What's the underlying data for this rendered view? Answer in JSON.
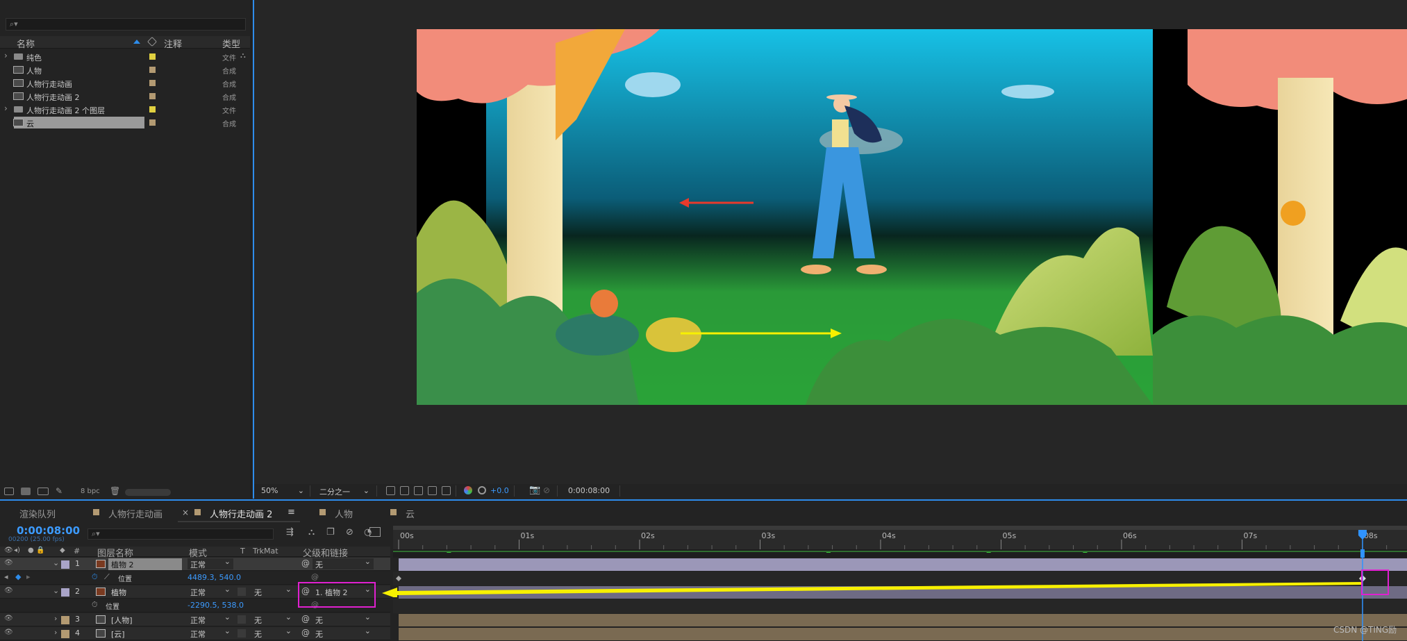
{
  "colors": {
    "accent": "#2d8ceb",
    "timecode": "#3c9bff",
    "label_yellow": "#e0d040",
    "label_tan": "#b39a72",
    "label_lavender": "#a9a4c8",
    "annotation_magenta": "#e020d0",
    "arrow_yellow": "#f7f000",
    "arrow_red": "#e83a2c",
    "timeline_cursor": "#2f93ff"
  },
  "project": {
    "headers": {
      "name": "名称",
      "comment": "注释",
      "type": "类型"
    },
    "items": [
      {
        "name": "纯色",
        "type": "文件",
        "icon": "folder-icon",
        "label_color": "#e0d040"
      },
      {
        "name": "人物",
        "type": "合成",
        "icon": "composition-icon",
        "label_color": "#b39a72"
      },
      {
        "name": "人物行走动画",
        "type": "合成",
        "icon": "composition-icon",
        "label_color": "#b39a72"
      },
      {
        "name": "人物行走动画 2",
        "type": "合成",
        "icon": "composition-icon",
        "label_color": "#b39a72"
      },
      {
        "name": "人物行走动画 2 个图层",
        "type": "文件",
        "icon": "folder-icon",
        "label_color": "#e0d040"
      },
      {
        "name": "云",
        "type": "合成",
        "icon": "composition-icon",
        "label_color": "#b39a72",
        "selected": true
      }
    ],
    "bpc": "8 bpc"
  },
  "viewer": {
    "zoom": "50%",
    "resolution": "二分之一",
    "exposure": "+0.0",
    "timecode": "0:00:08:00"
  },
  "tabs": [
    {
      "label": "渲染队列",
      "active": false
    },
    {
      "label": "人物行走动画",
      "active": false
    },
    {
      "label": "人物行走动画 2",
      "active": true
    },
    {
      "label": "人物",
      "active": false
    },
    {
      "label": "云",
      "active": false
    }
  ],
  "timeline": {
    "timecode": "0:00:08:00",
    "frame_info": "00200 (25.00 fps)",
    "headers": {
      "num": "#",
      "layer_name": "图层名称",
      "mode": "模式",
      "t": "T",
      "trkmat": "TrkMat",
      "parent": "父级和链接"
    },
    "ruler": [
      "00s",
      "01s",
      "02s",
      "03s",
      "04s",
      "05s",
      "06s",
      "07s",
      "08s"
    ],
    "current_time_s": 8,
    "duration_s": 8.3,
    "layers": [
      {
        "num": "1",
        "name": "植物 2",
        "mode": "正常",
        "trkmat": "",
        "parent": "无",
        "label_color": "#a9a4c8",
        "selected": true,
        "prop": {
          "name": "位置",
          "value": "4489.3, 540.0"
        }
      },
      {
        "num": "2",
        "name": "植物",
        "mode": "正常",
        "trkmat": "无",
        "parent": "1. 植物 2",
        "label_color": "#a9a4c8",
        "prop": {
          "name": "位置",
          "value": "-2290.5, 538.0"
        }
      },
      {
        "num": "3",
        "name": "[人物]",
        "mode": "正常",
        "trkmat": "无",
        "parent": "无",
        "label_color": "#b39a72"
      },
      {
        "num": "4",
        "name": "[云]",
        "mode": "正常",
        "trkmat": "无",
        "parent": "无",
        "label_color": "#b39a72"
      }
    ]
  },
  "watermark": "CSDN @TING励"
}
